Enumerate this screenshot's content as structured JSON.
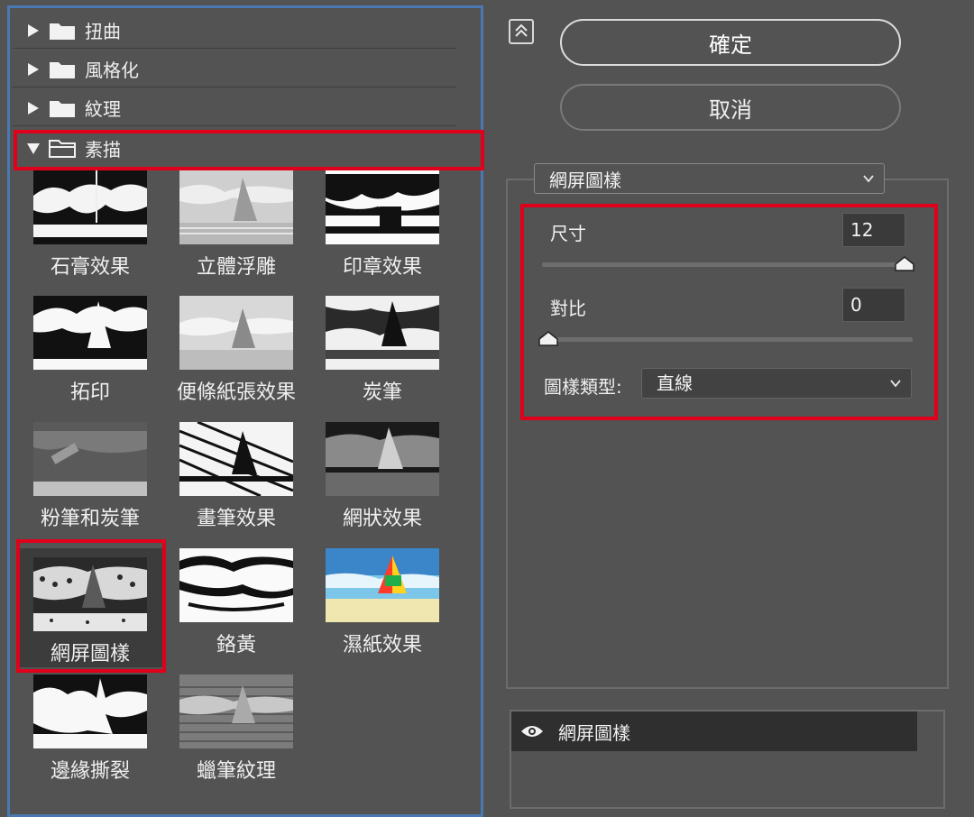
{
  "gallery": {
    "categories": [
      {
        "label": "扭曲",
        "expanded": false
      },
      {
        "label": "風格化",
        "expanded": false
      },
      {
        "label": "紋理",
        "expanded": false
      },
      {
        "label": "素描",
        "expanded": true
      }
    ],
    "filters": [
      "石膏效果",
      "立體浮雕",
      "印章效果",
      "拓印",
      "便條紙張效果",
      "炭筆",
      "粉筆和炭筆",
      "畫筆效果",
      "網狀效果",
      "網屏圖樣",
      "鉻黃",
      "濕紙效果",
      "邊緣撕裂",
      "蠟筆紋理"
    ],
    "selected_filter": "網屏圖樣"
  },
  "actions": {
    "ok_label": "確定",
    "cancel_label": "取消"
  },
  "settings": {
    "filter_name": "網屏圖樣",
    "size_label": "尺寸",
    "size_value": "12",
    "contrast_label": "對比",
    "contrast_value": "0",
    "pattern_type_label": "圖樣類型:",
    "pattern_type_value": "直線"
  },
  "layers": {
    "items": [
      {
        "name": "網屏圖樣",
        "visible": true
      }
    ]
  },
  "icons": {
    "folder": "folder-icon",
    "expand": "triangle-right-icon",
    "collapse": "collapse-up-icon",
    "eye": "eye-icon",
    "chevron": "chevron-down-icon",
    "slider": "slider-knob-icon"
  },
  "colors": {
    "highlight": "#e0001b",
    "selection_border": "#4a78b0",
    "panel_bg": "#535353"
  }
}
